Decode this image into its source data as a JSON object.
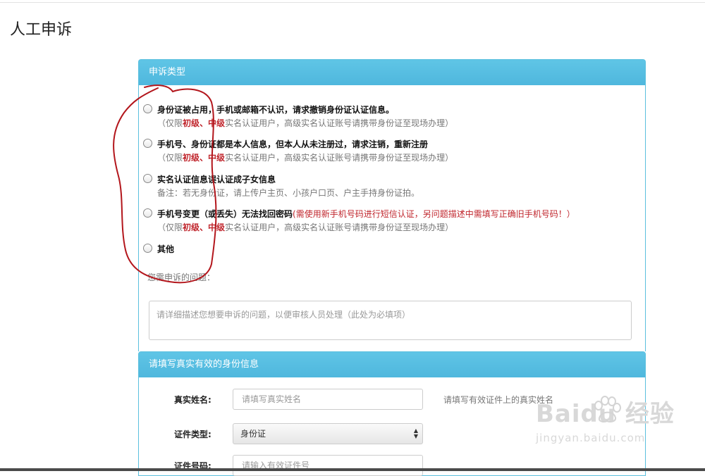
{
  "page": {
    "title": "人工申诉"
  },
  "complaint_panel": {
    "heading": "申诉类型",
    "options": [
      {
        "main": "身份证被占用，手机或邮箱不认识，请求撤销身份证认证信息。",
        "sub_prefix": "（仅限",
        "sub_level1": "初级",
        "sub_sep": "、",
        "sub_level2": "中级",
        "sub_suffix": "实名认证用户，高级实名认证账号请携带身份证至现场办理）"
      },
      {
        "main": "手机号、身份证都是本人信息，但本人从未注册过，请求注销，重新注册",
        "sub_prefix": "（仅限",
        "sub_level1": "初级",
        "sub_sep": "、",
        "sub_level2": "中级",
        "sub_suffix": "实名认证用户，高级实名认证账号请携带身份证至现场办理）"
      },
      {
        "main": "实名认证信息误认证成子女信息",
        "sub": "备注：若无身份证，请上传户主页、小孩户口页、户主手持身份证拍。"
      },
      {
        "main": "手机号变更（或丢失）无法找回密码",
        "main_note": "(需使用新手机号码进行短信认证，另问题描述中需填写正确旧手机号码！）",
        "sub_prefix": "（仅限",
        "sub_level1": "初级",
        "sub_sep": "、",
        "sub_level2": "中级",
        "sub_suffix": "实名认证用户，高级实名认证账号请携带身份证至现场办理）"
      },
      {
        "main": "其他"
      }
    ],
    "question_label": "您需申诉的问题：",
    "question_placeholder": "请详细描述您想要申诉的问题，以便审核人员处理（此处为必填项）"
  },
  "identity_panel": {
    "heading": "请填写真实有效的身份信息",
    "name_label": "真实姓名:",
    "name_placeholder": "请填写真实姓名",
    "name_hint": "请填写有效证件上的真实姓名",
    "id_type_label": "证件类型:",
    "id_type_value": "身份证",
    "id_number_label": "证件号码:",
    "id_number_placeholder": "请输入有效证件号"
  },
  "watermark": {
    "logo": "Baidu 经验",
    "url": "jingyan.baidu.com"
  },
  "colors": {
    "panel_heading": "#5bc0de",
    "level_red": "#c0262d",
    "annotation_red": "#b3161c"
  }
}
